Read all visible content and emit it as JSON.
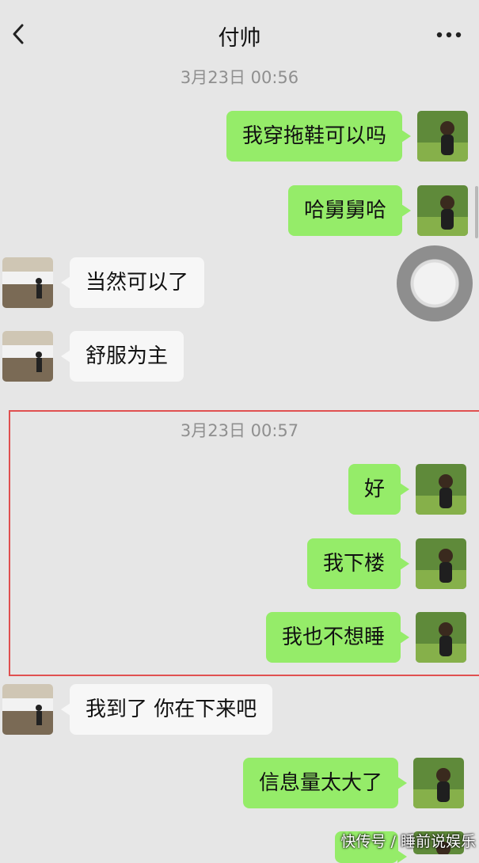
{
  "header": {
    "title": "付帅",
    "back_icon": "chevron-left-icon",
    "more_icon": "more-dots-icon"
  },
  "timestamps": [
    "3月23日 00:56",
    "3月23日 00:57"
  ],
  "messages": [
    {
      "from": "me",
      "text": "我穿拖鞋可以吗"
    },
    {
      "from": "me",
      "text": "哈舅舅哈"
    },
    {
      "from": "other",
      "text": "当然可以了"
    },
    {
      "from": "other",
      "text": "舒服为主"
    },
    {
      "from": "me",
      "text": "好"
    },
    {
      "from": "me",
      "text": "我下楼"
    },
    {
      "from": "me",
      "text": "我也不想睡"
    },
    {
      "from": "other",
      "text": "我到了 你在下来吧"
    },
    {
      "from": "me",
      "text": "信息量太大了"
    }
  ],
  "watermark": "快传号 / 睡前说娱乐",
  "colors": {
    "background": "#e6e6e6",
    "my_bubble": "#95ec69",
    "other_bubble": "#f7f7f7",
    "highlight_border": "#e05050",
    "timestamp": "#8f8f8f"
  }
}
